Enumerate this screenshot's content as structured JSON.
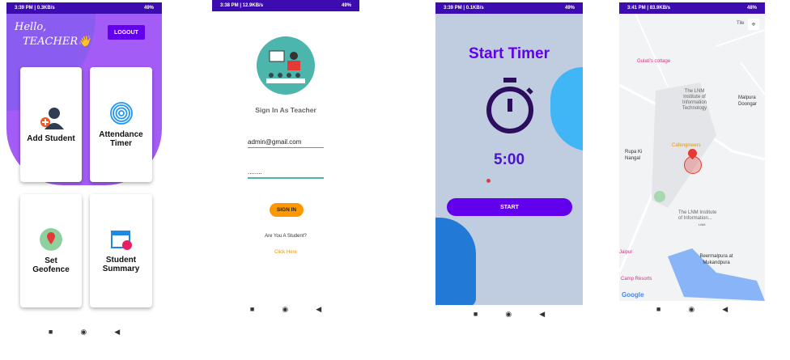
{
  "phone1": {
    "status_time": "3:39 PM | 0.3KB/s",
    "battery": "49%",
    "greeting_line1": "Hello,",
    "greeting_line2": "TEACHER",
    "logout": "LOGOUT",
    "cards": [
      {
        "label": "Add Student",
        "icon": "add-user-icon"
      },
      {
        "label": "Attendance Timer",
        "icon": "fingerprint-icon"
      },
      {
        "label": "Set Geofence",
        "icon": "map-pin-icon"
      },
      {
        "label": "Student Summary",
        "icon": "calendar-icon"
      }
    ]
  },
  "phone2": {
    "status_time": "3:38 PM | 12.9KB/s",
    "battery": "49%",
    "title": "Sign In As Teacher",
    "email": "admin@gmail.com",
    "password": "........",
    "sign_in": "SIGN IN",
    "student_prompt": "Are You A Student?",
    "click_here": "Click Here"
  },
  "phone3": {
    "status_time": "3:39 PM | 0.1KB/s",
    "battery": "49%",
    "title": "Start Timer",
    "timer": "5:00",
    "start": "START"
  },
  "phone4": {
    "status_time": "3:41 PM | 83.9KB/s",
    "battery": "48%",
    "labels": [
      "Tile",
      "Gulati's cottage",
      "The LNM Institute of Information Technology",
      "Malpura Doongar",
      "Cafengineers",
      "Rupa Ki Nangal",
      "The LNM Institute of Information...",
      "LNM",
      "Jaipur",
      "Beermalpura at Mukandpura",
      "Camp Resorts"
    ],
    "google": "Google"
  },
  "colors": {
    "status": "#3d0cb0",
    "purple": "#a35cf5",
    "accent": "#6200ee",
    "orange": "#ff9800",
    "timer_bg": "#c0cde0"
  },
  "nav": {
    "back": "◀",
    "home": "◉",
    "recent": "■"
  }
}
